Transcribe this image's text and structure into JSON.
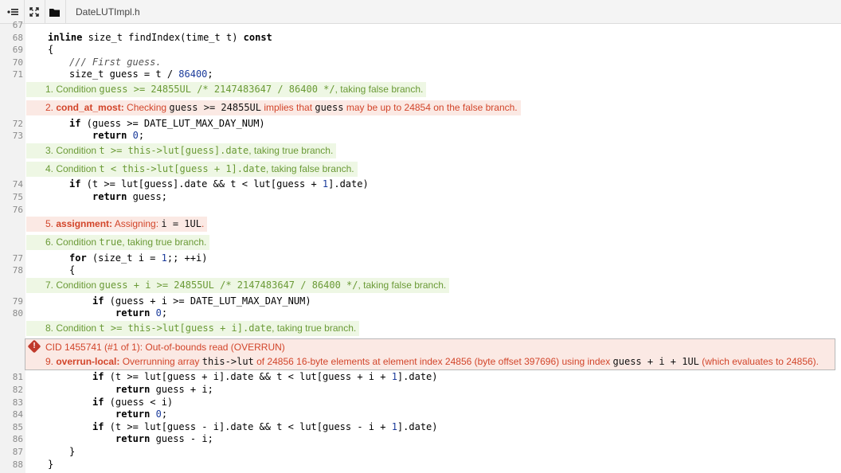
{
  "file": {
    "name": "DateLUTImpl.h"
  },
  "toolbar": {
    "outline_icon": "outline-icon",
    "expand_icon": "expand-icon",
    "folder_icon": "folder-icon"
  },
  "lines": {
    "l67": "67",
    "l68": "68",
    "l69": "69",
    "l70": "70",
    "l71": "71",
    "l72": "72",
    "l73": "73",
    "l74": "74",
    "l75": "75",
    "l76": "76",
    "l77": "77",
    "l78": "78",
    "l79": "79",
    "l80": "80",
    "l81": "81",
    "l82": "82",
    "l83": "83",
    "l84": "84",
    "l85": "85",
    "l86": "86",
    "l87": "87",
    "l88": "88"
  },
  "code": {
    "c68a": "inline",
    "c68b": " size_t findIndex(time_t t) ",
    "c68c": "const",
    "c69": "{",
    "c70": "/// First guess.",
    "c71a": "size_t guess = t / ",
    "c71b": "86400",
    "c71c": ";",
    "c72a": "if",
    "c72b": " (guess >= DATE_LUT_MAX_DAY_NUM)",
    "c73a": "return",
    "c73b": " ",
    "c73c": "0",
    "c73d": ";",
    "c74a": "if",
    "c74b": " (t >= lut[guess].date && t < lut[guess + ",
    "c74c": "1",
    "c74d": "].date)",
    "c75a": "return",
    "c75b": " guess;",
    "c77a": "for",
    "c77b": " (size_t i = ",
    "c77c": "1",
    "c77d": ";; ++i)",
    "c78": "{",
    "c79a": "if",
    "c79b": " (guess + i >= DATE_LUT_MAX_DAY_NUM)",
    "c80a": "return",
    "c80b": " ",
    "c80c": "0",
    "c80d": ";",
    "c81a": "if",
    "c81b": " (t >= lut[guess + i].date && t < lut[guess + i + ",
    "c81c": "1",
    "c81d": "].date)",
    "c82a": "return",
    "c82b": " guess + i;",
    "c83a": "if",
    "c83b": " (guess < i)",
    "c84a": "return",
    "c84b": " ",
    "c84c": "0",
    "c84d": ";",
    "c85a": "if",
    "c85b": " (t >= lut[guess - i].date && t < lut[guess - i + ",
    "c85c": "1",
    "c85d": "].date)",
    "c86a": "return",
    "c86b": " guess - i;",
    "c87": "}",
    "c88": "}"
  },
  "events": {
    "e1a": "1. Condition ",
    "e1b": "guess >= 24855UL /* 2147483647 / 86400 */",
    "e1c": ", taking false branch.",
    "e2a": "2. ",
    "e2tag": "cond_at_most:",
    "e2b": " Checking ",
    "e2c": "guess >= 24855UL",
    "e2d": " implies that ",
    "e2e": "guess",
    "e2f": " may be up to 24854 on the false branch.",
    "e3a": "3. Condition ",
    "e3b": "t >= this->lut[guess].date",
    "e3c": ", taking true branch.",
    "e4a": "4. Condition ",
    "e4b": "t < this->lut[guess + 1].date",
    "e4c": ", taking false branch.",
    "e5a": "5. ",
    "e5tag": "assignment:",
    "e5b": " Assigning: ",
    "e5c": "i = 1UL",
    "e5d": ".",
    "e6a": "6. Condition ",
    "e6b": "true",
    "e6c": ", taking true branch.",
    "e7a": "7. Condition ",
    "e7b": "guess + i >= 24855UL /* 2147483647 / 86400 */",
    "e7c": ", taking false branch.",
    "e8a": "8. Condition ",
    "e8b": "t >= this->lut[guess + i].date",
    "e8c": ", taking true branch."
  },
  "defect": {
    "title": "CID 1455741 (#1 of 1): Out-of-bounds read (OVERRUN)",
    "num": "9. ",
    "tag": "overrun-local:",
    "t1": " Overrunning array ",
    "t2": "this->lut",
    "t3": " of 24856 16-byte elements at element index 24856 (byte offset 397696) using index ",
    "t4": "guess + i + 1UL",
    "t5": " (which evaluates to 24856)."
  },
  "colors": {
    "green_text": "#6a9a36",
    "green_bg": "#eef7e4",
    "red_text": "#d2452a",
    "red_bg": "#fbe9e4"
  }
}
